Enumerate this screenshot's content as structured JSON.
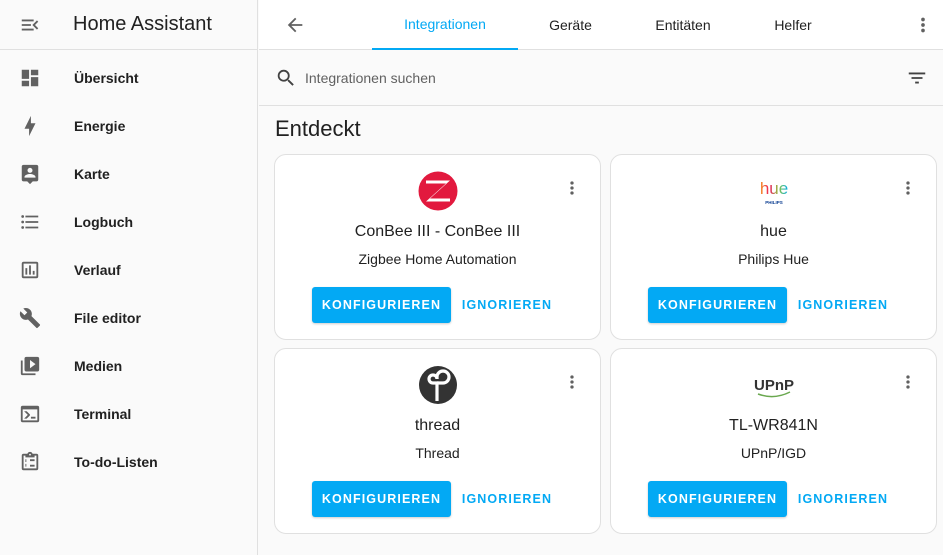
{
  "app": {
    "title": "Home Assistant"
  },
  "sidebar": {
    "items": [
      {
        "label": "Übersicht",
        "icon": "dashboard-icon"
      },
      {
        "label": "Energie",
        "icon": "lightning-icon"
      },
      {
        "label": "Karte",
        "icon": "account-box-icon"
      },
      {
        "label": "Logbuch",
        "icon": "format-list-icon"
      },
      {
        "label": "Verlauf",
        "icon": "chart-box-icon"
      },
      {
        "label": "File editor",
        "icon": "wrench-icon"
      },
      {
        "label": "Medien",
        "icon": "play-box-multiple-icon"
      },
      {
        "label": "Terminal",
        "icon": "console-icon"
      },
      {
        "label": "To-do-Listen",
        "icon": "clipboard-list-icon"
      }
    ]
  },
  "tabs": [
    {
      "label": "Integrationen",
      "active": true
    },
    {
      "label": "Geräte",
      "active": false
    },
    {
      "label": "Entitäten",
      "active": false
    },
    {
      "label": "Helfer",
      "active": false
    }
  ],
  "search": {
    "placeholder": "Integrationen suchen"
  },
  "section": {
    "title": "Entdeckt"
  },
  "cards": [
    {
      "name": "ConBee III - ConBee III",
      "integration": "Zigbee Home Automation",
      "logo": "zigbee-logo-icon",
      "configure_label": "KONFIGURIEREN",
      "ignore_label": "IGNORIEREN"
    },
    {
      "name": "hue",
      "integration": "Philips Hue",
      "logo": "hue-logo-icon",
      "logo_text": "hue",
      "logo_subtext": "PHILIPS",
      "configure_label": "KONFIGURIEREN",
      "ignore_label": "IGNORIEREN"
    },
    {
      "name": "thread",
      "integration": "Thread",
      "logo": "thread-logo-icon",
      "configure_label": "KONFIGURIEREN",
      "ignore_label": "IGNORIEREN"
    },
    {
      "name": "TL-WR841N",
      "integration": "UPnP/IGD",
      "logo": "upnp-logo-icon",
      "logo_text": "UPnP",
      "configure_label": "KONFIGURIEREN",
      "ignore_label": "IGNORIEREN"
    }
  ],
  "colors": {
    "accent": "#03a9f4",
    "icon": "#616161",
    "zigbee": "#e2193e",
    "thread": "#333333"
  }
}
